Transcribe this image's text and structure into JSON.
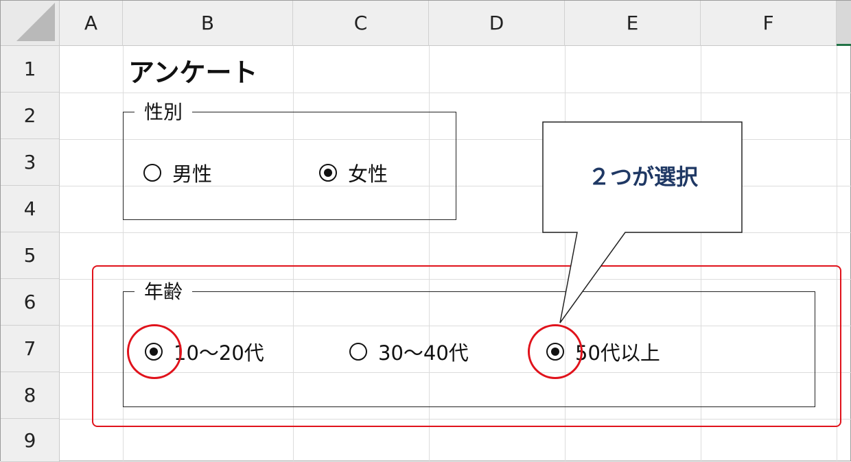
{
  "columns": [
    "A",
    "B",
    "C",
    "D",
    "E",
    "F"
  ],
  "rows": [
    "1",
    "2",
    "3",
    "4",
    "5",
    "6",
    "7",
    "8",
    "9"
  ],
  "sheet_title": "アンケート",
  "gender_group": {
    "label": "性別",
    "options": [
      {
        "label": "男性",
        "checked": false
      },
      {
        "label": "女性",
        "checked": true
      }
    ]
  },
  "age_group": {
    "label": "年齢",
    "options": [
      {
        "label": "10～20代",
        "checked": true
      },
      {
        "label": "30～40代",
        "checked": false
      },
      {
        "label": "50代以上",
        "checked": true
      }
    ]
  },
  "callout": {
    "text": "２つが選択"
  },
  "colors": {
    "highlight": "#e0121b",
    "callout_text": "#1f3864",
    "header_bg": "#efefef"
  }
}
